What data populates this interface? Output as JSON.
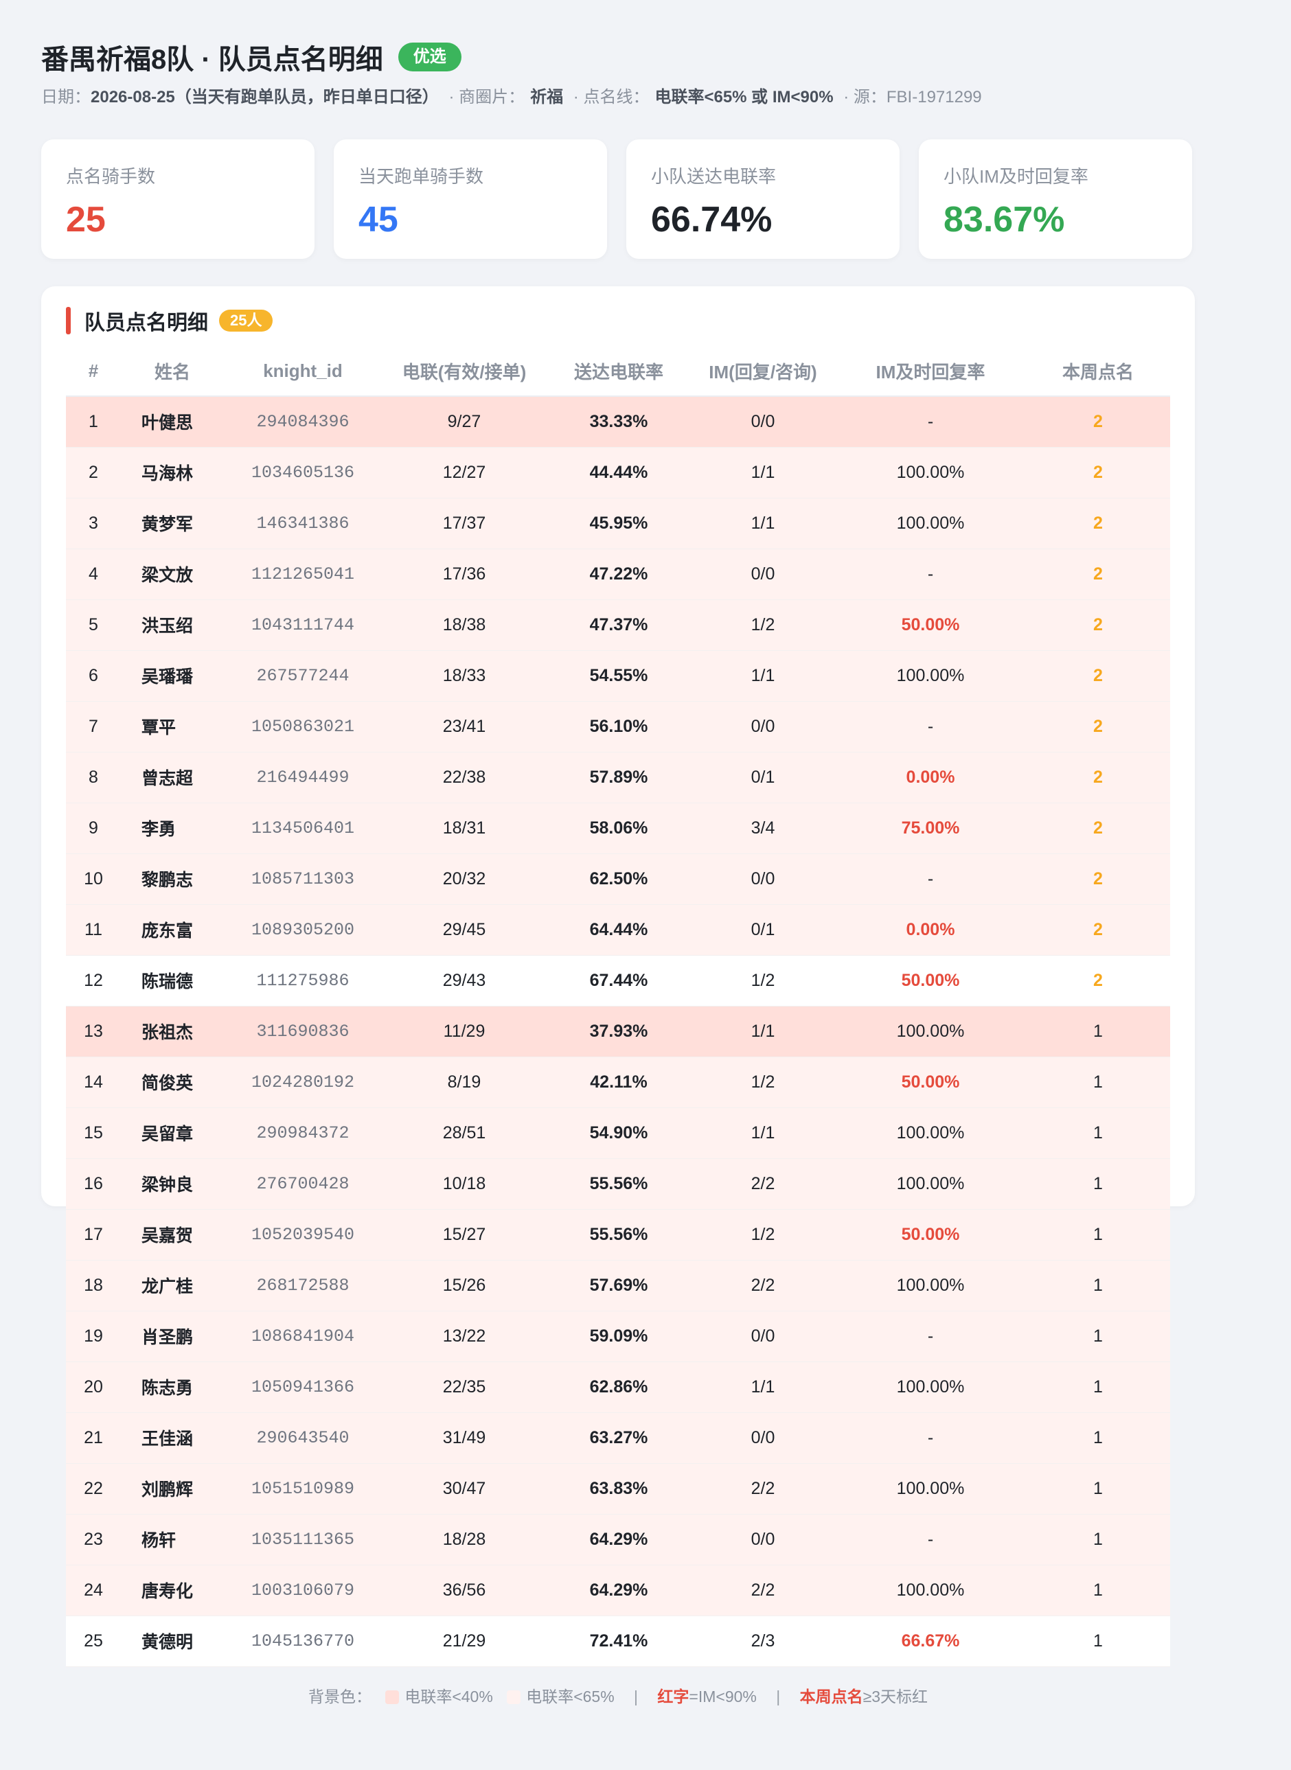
{
  "header": {
    "title": "番禺祈福8队 · 队员点名明细",
    "badge": "优选",
    "date_label": "日期：",
    "date_value": "2026-08-25（当天有跑单队员，昨日单日口径）",
    "area_label": "· 商圈片：",
    "area_value": "祈福",
    "line_label": "· 点名线：",
    "line_value": "电联率<65% 或 IM<90%",
    "source_text": "· 源：FBI-1971299"
  },
  "stats": [
    {
      "label": "点名骑手数",
      "value": "25",
      "color": "#e54b3c"
    },
    {
      "label": "当天跑单骑手数",
      "value": "45",
      "color": "#3477f5"
    },
    {
      "label": "小队送达电联率",
      "value": "66.74%",
      "color": "#1f2329"
    },
    {
      "label": "小队IM及时回复率",
      "value": "83.67%",
      "color": "#34a853"
    }
  ],
  "table_card": {
    "title": "队员点名明细",
    "count_badge": "25人",
    "columns": [
      "#",
      "姓名",
      "knight_id",
      "电联(有效/接单)",
      "送达电联率",
      "IM(回复/咨询)",
      "IM及时回复率",
      "本周点名"
    ],
    "rows": [
      {
        "no": "1",
        "name": "叶健思",
        "id": "294084396",
        "call": "9/27",
        "rate": "33.33%",
        "im": "0/0",
        "im_rate": "-",
        "week": "2",
        "bg": "deep",
        "im_red": false
      },
      {
        "no": "2",
        "name": "马海林",
        "id": "1034605136",
        "call": "12/27",
        "rate": "44.44%",
        "im": "1/1",
        "im_rate": "100.00%",
        "week": "2",
        "bg": "light",
        "im_red": false
      },
      {
        "no": "3",
        "name": "黄梦军",
        "id": "146341386",
        "call": "17/37",
        "rate": "45.95%",
        "im": "1/1",
        "im_rate": "100.00%",
        "week": "2",
        "bg": "light",
        "im_red": false
      },
      {
        "no": "4",
        "name": "梁文放",
        "id": "1121265041",
        "call": "17/36",
        "rate": "47.22%",
        "im": "0/0",
        "im_rate": "-",
        "week": "2",
        "bg": "light",
        "im_red": false
      },
      {
        "no": "5",
        "name": "洪玉绍",
        "id": "1043111744",
        "call": "18/38",
        "rate": "47.37%",
        "im": "1/2",
        "im_rate": "50.00%",
        "week": "2",
        "bg": "light",
        "im_red": true
      },
      {
        "no": "6",
        "name": "吴璠璠",
        "id": "267577244",
        "call": "18/33",
        "rate": "54.55%",
        "im": "1/1",
        "im_rate": "100.00%",
        "week": "2",
        "bg": "light",
        "im_red": false
      },
      {
        "no": "7",
        "name": "覃平",
        "id": "1050863021",
        "call": "23/41",
        "rate": "56.10%",
        "im": "0/0",
        "im_rate": "-",
        "week": "2",
        "bg": "light",
        "im_red": false
      },
      {
        "no": "8",
        "name": "曾志超",
        "id": "216494499",
        "call": "22/38",
        "rate": "57.89%",
        "im": "0/1",
        "im_rate": "0.00%",
        "week": "2",
        "bg": "light",
        "im_red": true
      },
      {
        "no": "9",
        "name": "李勇",
        "id": "1134506401",
        "call": "18/31",
        "rate": "58.06%",
        "im": "3/4",
        "im_rate": "75.00%",
        "week": "2",
        "bg": "light",
        "im_red": true
      },
      {
        "no": "10",
        "name": "黎鹏志",
        "id": "1085711303",
        "call": "20/32",
        "rate": "62.50%",
        "im": "0/0",
        "im_rate": "-",
        "week": "2",
        "bg": "light",
        "im_red": false
      },
      {
        "no": "11",
        "name": "庞东富",
        "id": "1089305200",
        "call": "29/45",
        "rate": "64.44%",
        "im": "0/1",
        "im_rate": "0.00%",
        "week": "2",
        "bg": "light",
        "im_red": true
      },
      {
        "no": "12",
        "name": "陈瑞德",
        "id": "111275986",
        "call": "29/43",
        "rate": "67.44%",
        "im": "1/2",
        "im_rate": "50.00%",
        "week": "2",
        "bg": "none",
        "im_red": true
      },
      {
        "no": "13",
        "name": "张祖杰",
        "id": "311690836",
        "call": "11/29",
        "rate": "37.93%",
        "im": "1/1",
        "im_rate": "100.00%",
        "week": "1",
        "bg": "deep",
        "im_red": false
      },
      {
        "no": "14",
        "name": "简俊英",
        "id": "1024280192",
        "call": "8/19",
        "rate": "42.11%",
        "im": "1/2",
        "im_rate": "50.00%",
        "week": "1",
        "bg": "light",
        "im_red": true
      },
      {
        "no": "15",
        "name": "吴留章",
        "id": "290984372",
        "call": "28/51",
        "rate": "54.90%",
        "im": "1/1",
        "im_rate": "100.00%",
        "week": "1",
        "bg": "light",
        "im_red": false
      },
      {
        "no": "16",
        "name": "梁钟良",
        "id": "276700428",
        "call": "10/18",
        "rate": "55.56%",
        "im": "2/2",
        "im_rate": "100.00%",
        "week": "1",
        "bg": "light",
        "im_red": false
      },
      {
        "no": "17",
        "name": "吴嘉贺",
        "id": "1052039540",
        "call": "15/27",
        "rate": "55.56%",
        "im": "1/2",
        "im_rate": "50.00%",
        "week": "1",
        "bg": "light",
        "im_red": true
      },
      {
        "no": "18",
        "name": "龙广桂",
        "id": "268172588",
        "call": "15/26",
        "rate": "57.69%",
        "im": "2/2",
        "im_rate": "100.00%",
        "week": "1",
        "bg": "light",
        "im_red": false
      },
      {
        "no": "19",
        "name": "肖圣鹏",
        "id": "1086841904",
        "call": "13/22",
        "rate": "59.09%",
        "im": "0/0",
        "im_rate": "-",
        "week": "1",
        "bg": "light",
        "im_red": false
      },
      {
        "no": "20",
        "name": "陈志勇",
        "id": "1050941366",
        "call": "22/35",
        "rate": "62.86%",
        "im": "1/1",
        "im_rate": "100.00%",
        "week": "1",
        "bg": "light",
        "im_red": false
      },
      {
        "no": "21",
        "name": "王佳涵",
        "id": "290643540",
        "call": "31/49",
        "rate": "63.27%",
        "im": "0/0",
        "im_rate": "-",
        "week": "1",
        "bg": "light",
        "im_red": false
      },
      {
        "no": "22",
        "name": "刘鹏辉",
        "id": "1051510989",
        "call": "30/47",
        "rate": "63.83%",
        "im": "2/2",
        "im_rate": "100.00%",
        "week": "1",
        "bg": "light",
        "im_red": false
      },
      {
        "no": "23",
        "name": "杨轩",
        "id": "1035111365",
        "call": "18/28",
        "rate": "64.29%",
        "im": "0/0",
        "im_rate": "-",
        "week": "1",
        "bg": "light",
        "im_red": false
      },
      {
        "no": "24",
        "name": "唐寿化",
        "id": "1003106079",
        "call": "36/56",
        "rate": "64.29%",
        "im": "2/2",
        "im_rate": "100.00%",
        "week": "1",
        "bg": "light",
        "im_red": false
      },
      {
        "no": "25",
        "name": "黄德明",
        "id": "1045136770",
        "call": "21/29",
        "rate": "72.41%",
        "im": "2/3",
        "im_rate": "66.67%",
        "week": "1",
        "bg": "none",
        "im_red": true
      }
    ]
  },
  "legend": {
    "prefix": "背景色：",
    "deep_label": "电联率<40%",
    "light_label": "电联率<65%",
    "pipe": "|",
    "red_word": "红字",
    "red_desc": "=IM<90%",
    "week_word": "本周点名",
    "week_desc": "≥3天标红"
  },
  "colors": {
    "accent_red": "#e54b3c",
    "bg_deep": "#ffdfda",
    "bg_light": "#fff2f0",
    "badge_green": "#3bb55c",
    "badge_orange": "#f7b52c",
    "week_hot": "#f7a81e"
  }
}
